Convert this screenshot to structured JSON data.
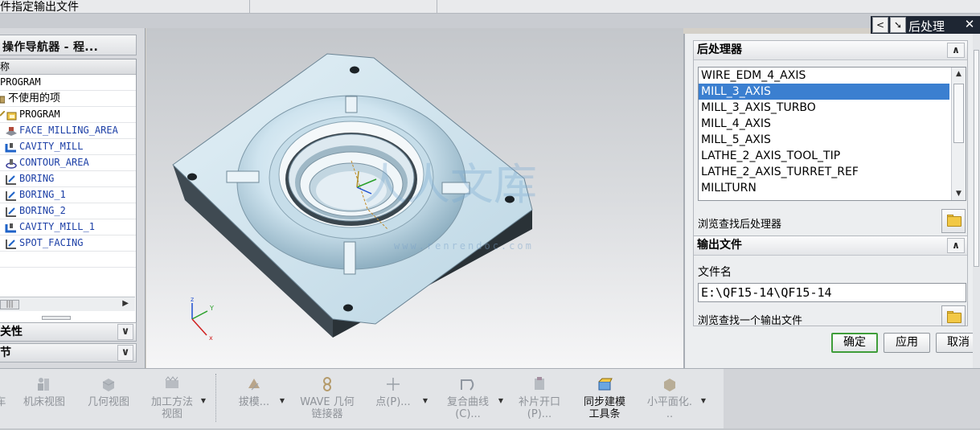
{
  "window": {
    "title": "件指定输出文件"
  },
  "navigator": {
    "title": "操作导航器 - 程...",
    "column_header": "称",
    "rows": [
      {
        "label": "PROGRAM",
        "icon": "none",
        "style": "plain"
      },
      {
        "label": "不使用的项",
        "icon": "unused-items-icon",
        "style": "cn"
      },
      {
        "label": "PROGRAM",
        "icon": "program-folder-icon",
        "style": "plain"
      },
      {
        "label": "FACE_MILLING_AREA",
        "icon": "face-mill-icon",
        "style": "blue"
      },
      {
        "label": "CAVITY_MILL",
        "icon": "cavity-mill-icon",
        "style": "blue"
      },
      {
        "label": "CONTOUR_AREA",
        "icon": "contour-icon",
        "style": "blue"
      },
      {
        "label": "BORING",
        "icon": "boring-icon",
        "style": "blue"
      },
      {
        "label": "BORING_1",
        "icon": "boring-icon",
        "style": "blue"
      },
      {
        "label": "BORING_2",
        "icon": "boring-icon",
        "style": "blue"
      },
      {
        "label": "CAVITY_MILL_1",
        "icon": "cavity-mill-icon",
        "style": "blue"
      },
      {
        "label": "SPOT_FACING",
        "icon": "boring-icon",
        "style": "blue"
      }
    ],
    "section1": "关性",
    "section2": "节"
  },
  "viewport": {
    "watermark": "人人文库",
    "watermark_url": "www.renrendoc.com",
    "axis_labels": {
      "x": "x",
      "y": "Y",
      "z": "z"
    }
  },
  "postprocess": {
    "header_title": "后处理",
    "group_title": "后处理器",
    "processors": [
      "WIRE_EDM_4_AXIS",
      "MILL_3_AXIS",
      "MILL_3_AXIS_TURBO",
      "MILL_4_AXIS",
      "MILL_5_AXIS",
      "LATHE_2_AXIS_TOOL_TIP",
      "LATHE_2_AXIS_TURRET_REF",
      "MILLTURN"
    ],
    "selected": "MILL_3_AXIS",
    "browse_post": "浏览查找后处理器",
    "output_group": "输出文件",
    "file_label": "文件名",
    "file_value": "E:\\QF15-14\\QF15-14",
    "browse_output": "浏览查找一个输出文件",
    "ok": "确定",
    "apply": "应用",
    "cancel": "取消",
    "accent": "#3b7fd0"
  },
  "toolbar": {
    "items": [
      {
        "label": "车",
        "state": "disabled"
      },
      {
        "label": "机床视图",
        "state": "disabled"
      },
      {
        "label": "几何视图",
        "state": "disabled"
      },
      {
        "label": "加工方法",
        "label2": "视图",
        "state": "disabled"
      },
      {
        "label": "拔模...",
        "state": "disabled"
      },
      {
        "label": "WAVE 几何",
        "label2": "链接器",
        "state": "disabled"
      },
      {
        "label": "点(P)...",
        "state": "disabled"
      },
      {
        "label": "复合曲线",
        "label2": "(C)...",
        "state": "disabled"
      },
      {
        "label": "补片开口",
        "label2": "(P)...",
        "state": "disabled"
      },
      {
        "label": "同步建模",
        "label2": "工具条",
        "state": "active"
      },
      {
        "label": "小平面化.",
        "label2": "..",
        "state": "disabled"
      }
    ]
  }
}
